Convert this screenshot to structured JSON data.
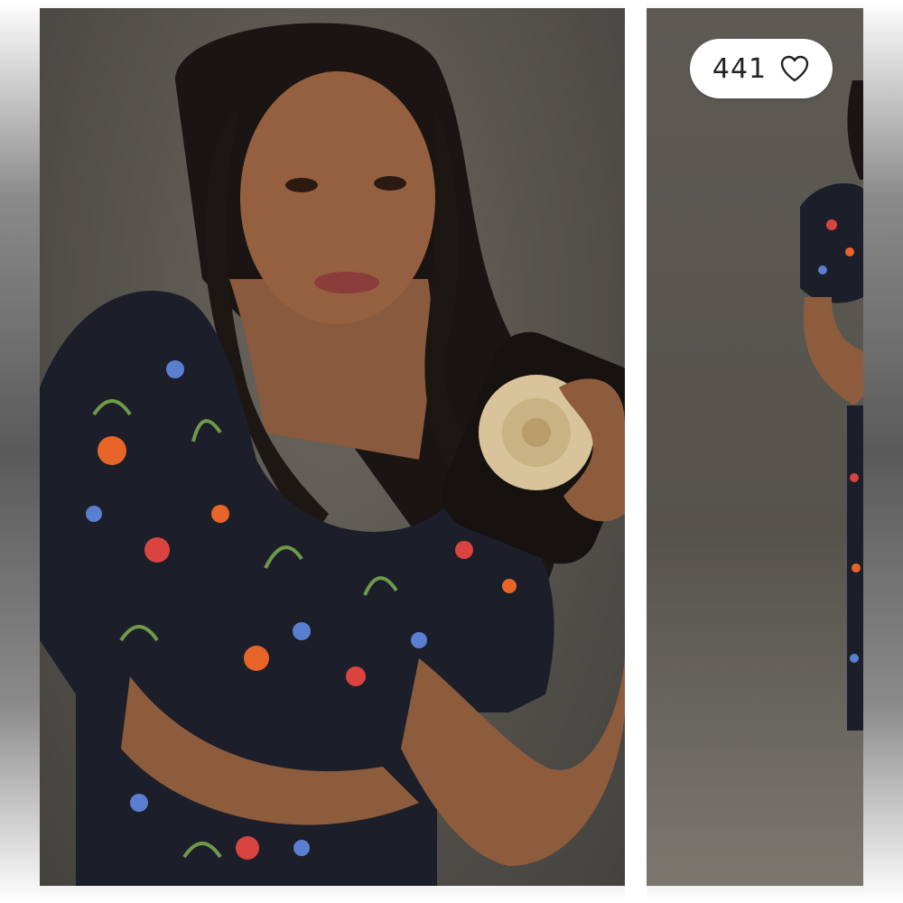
{
  "listing": {
    "like_count": "441",
    "like_icon": "heart-outline-icon"
  },
  "colors": {
    "backdrop": "#5d5a54",
    "dress": "#1c1f2a",
    "floral_orange": "#e8652a",
    "floral_red": "#d9443f",
    "floral_blue": "#5a7fd0",
    "floral_green": "#6f9a4a",
    "clutch_flower": "#d8c39a"
  }
}
